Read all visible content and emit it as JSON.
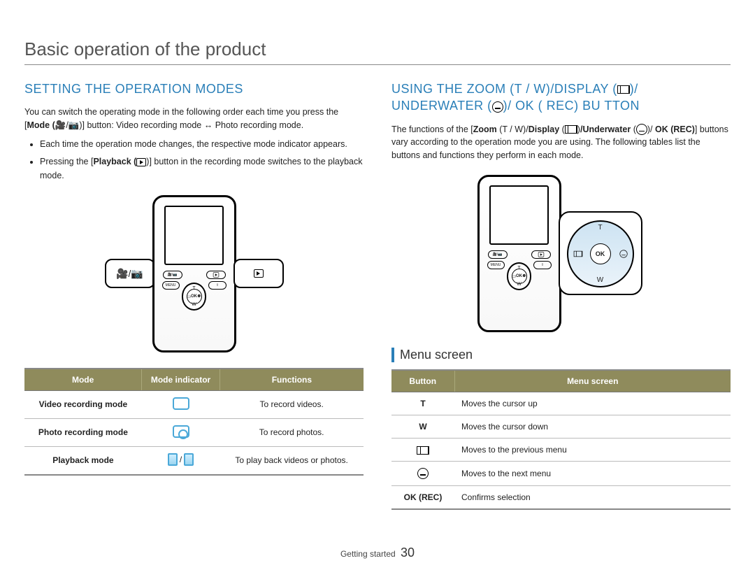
{
  "page_title": "Basic operation of the product",
  "left": {
    "heading": "SETTING THE OPERATION MODES",
    "intro_a": "You can switch the operating mode in the following order each time you press the [",
    "intro_mode_label": "Mode (",
    "intro_b": ")] button: Video recording mode ↔ Photo recording mode.",
    "bullet1": "Each time the operation mode changes, the respective mode indicator appears.",
    "bullet2_a": "Pressing the [",
    "bullet2_pb": "Playback (",
    "bullet2_b": ")] button in the recording mode switches to the playback mode.",
    "table": {
      "headers": {
        "mode": "Mode",
        "indicator": "Mode indicator",
        "functions": "Functions"
      },
      "rows": [
        {
          "mode": "Video recording mode",
          "fn": "To record videos."
        },
        {
          "mode": "Photo recording mode",
          "fn": "To record photos."
        },
        {
          "mode": "Playback mode",
          "fn": "To play back videos or photos."
        }
      ]
    }
  },
  "right": {
    "heading_a": "USING THE ZOOM (T / W)/DISPLAY (",
    "heading_b": ")/ UNDERWATER (",
    "heading_c": ")/ OK ( REC) BU TTON",
    "intro_a": "The functions of the [",
    "intro_zoom": "Zoom",
    "intro_tw": " (T / W)/",
    "intro_display": "Display",
    "intro_disp_open": " (",
    "intro_underwater": "/Underwater",
    "intro_uw_open": " (",
    "intro_okrec": "OK (REC)",
    "intro_b": "] buttons vary according to the operation mode you are using. The following tables list the buttons and functions they perform in each mode.",
    "subheading": "Menu screen",
    "table": {
      "headers": {
        "button": "Button",
        "menu": "Menu screen"
      },
      "rows": [
        {
          "btn": "T",
          "desc": "Moves the cursor up"
        },
        {
          "btn": "W",
          "desc": "Moves the cursor down"
        },
        {
          "btn": "DISPLAY_ICON",
          "desc": "Moves to the previous menu"
        },
        {
          "btn": "UNDERWATER_ICON",
          "desc": "Moves to the next menu"
        },
        {
          "btn": "OK (REC)",
          "desc": "Confirms selection"
        }
      ]
    }
  },
  "pad": {
    "t": "T",
    "w": "W",
    "ok": "OK"
  },
  "footer": {
    "section": "Getting started",
    "page": "30"
  }
}
